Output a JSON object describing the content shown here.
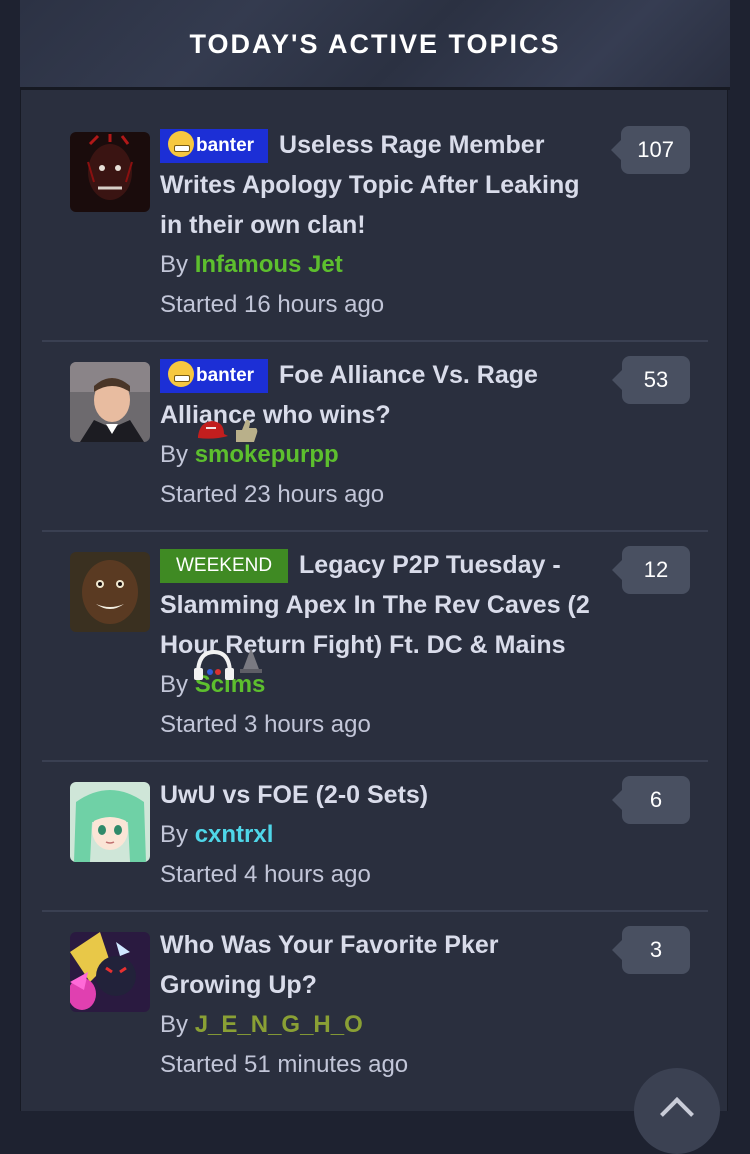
{
  "header": {
    "title": "TODAY'S ACTIVE TOPICS"
  },
  "topics": [
    {
      "tag": "banter",
      "title": "Useless Rage Member Writes Apology Topic After Leaking in their own clan!",
      "by": "By",
      "author": "Infamous Jet",
      "author_color": "#5dbf2e",
      "started": "Started 16 hours ago",
      "count": "107"
    },
    {
      "tag": "banter",
      "title": "Foe Alliance Vs. Rage Alliance who wins?",
      "by": "By",
      "author": "smokepurpp",
      "author_color": "#5dbf2e",
      "started": "Started 23 hours ago",
      "count": "53"
    },
    {
      "tag": "WEEKEND",
      "title": "Legacy P2P Tuesday - Slamming Apex In The Rev Caves (2 Hour Return Fight) Ft. DC & Mains",
      "by": "By",
      "author": "Sclms",
      "author_color": "#5dbf2e",
      "started": "Started 3 hours ago",
      "count": "12"
    },
    {
      "title": "UwU vs FOE (2-0 Sets)",
      "by": "By",
      "author": "cxntrxl",
      "author_color": "#4fd6e8",
      "started": "Started 4 hours ago",
      "count": "6"
    },
    {
      "title": "Who Was Your Favorite Pker Growing Up?",
      "by": "By",
      "author": "J_E_N_G_H_O",
      "author_color": "#8aa035",
      "started": "Started 51 minutes ago",
      "count": "3"
    }
  ],
  "colors": {
    "banter_tag": "#1c2fd6",
    "weekend_tag": "#3f8a23",
    "count_bubble": "#495061"
  }
}
